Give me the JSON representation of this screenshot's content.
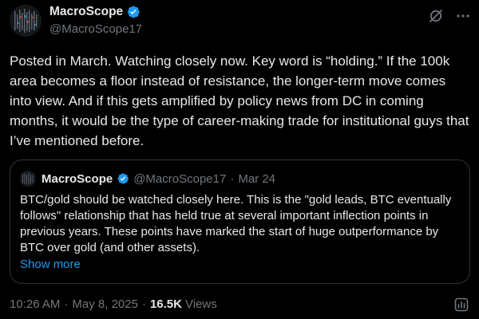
{
  "author": {
    "display_name": "MacroScope",
    "handle": "@MacroScope17",
    "verified": true
  },
  "tweet": {
    "text": "Posted in March. Watching closely now. Key word is “holding.” If the 100k area becomes a floor instead of resistance, the longer-term move comes into view. And if this gets amplified by policy news from DC in coming months, it would be the type of career-making trade for institutional guys that I’ve mentioned before."
  },
  "quoted": {
    "display_name": "MacroScope",
    "handle": "@MacroScope17",
    "separator": "·",
    "date": "Mar 24",
    "text": "BTC/gold should be watched closely here. This is the \"gold leads, BTC eventually follows\" relationship that has held true at several important inflection points in previous years. These points have marked the start of huge outperformance by BTC over gold (and other assets).",
    "show_more_label": "Show more"
  },
  "meta": {
    "time": "10:26 AM",
    "separator1": "·",
    "date": "May 8, 2025",
    "separator2": "·",
    "views_count": "16.5K",
    "views_label": "Views"
  },
  "icons": {
    "verified": "verified-badge-icon",
    "grok": "grok-icon",
    "more": "more-dots-icon",
    "analytics": "analytics-icon"
  },
  "colors": {
    "background": "#000000",
    "text": "#e7e9ea",
    "muted": "#71767b",
    "accent": "#1d9bf0",
    "border": "#2f3336"
  }
}
